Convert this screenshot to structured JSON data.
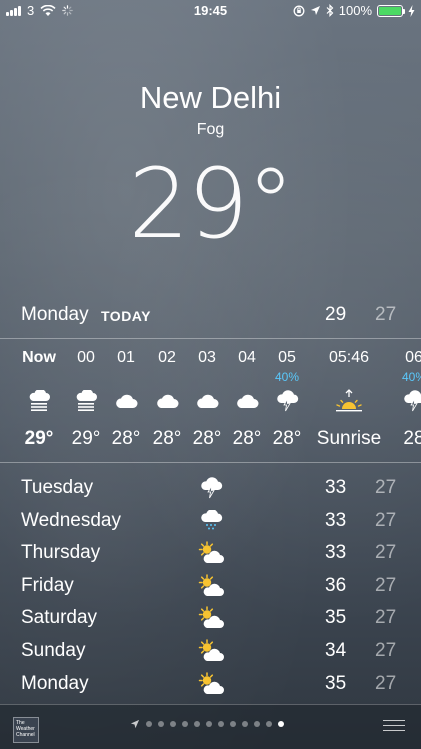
{
  "status_bar": {
    "carrier": "3",
    "time": "19:45",
    "battery": "100%",
    "battery_level": 1.0
  },
  "header": {
    "city": "New Delhi",
    "condition": "Fog",
    "temperature": "29°"
  },
  "today": {
    "day": "Monday",
    "tag": "TODAY",
    "high": "29",
    "low": "27"
  },
  "hourly": [
    {
      "hour": "Now",
      "icon": "fog-icon",
      "precip": "",
      "temp": "29°"
    },
    {
      "hour": "00",
      "icon": "fog-icon",
      "precip": "",
      "temp": "29°"
    },
    {
      "hour": "01",
      "icon": "cloud-icon",
      "precip": "",
      "temp": "28°"
    },
    {
      "hour": "02",
      "icon": "cloud-icon",
      "precip": "",
      "temp": "28°"
    },
    {
      "hour": "03",
      "icon": "cloud-icon",
      "precip": "",
      "temp": "28°"
    },
    {
      "hour": "04",
      "icon": "cloud-icon",
      "precip": "",
      "temp": "28°"
    },
    {
      "hour": "05",
      "icon": "thunderstorm-icon",
      "precip": "40%",
      "temp": "28°"
    },
    {
      "hour": "05:46",
      "icon": "sunrise-icon",
      "precip": "",
      "temp": "Sunrise"
    },
    {
      "hour": "06",
      "icon": "thunderstorm-icon",
      "precip": "40%",
      "temp": "28"
    }
  ],
  "daily": [
    {
      "day": "Tuesday",
      "icon": "thunderstorm-icon",
      "high": "33",
      "low": "27"
    },
    {
      "day": "Wednesday",
      "icon": "rain-cloud-icon",
      "high": "33",
      "low": "27"
    },
    {
      "day": "Thursday",
      "icon": "partly-cloudy-icon",
      "high": "33",
      "low": "27"
    },
    {
      "day": "Friday",
      "icon": "partly-cloudy-icon",
      "high": "36",
      "low": "27"
    },
    {
      "day": "Saturday",
      "icon": "partly-cloudy-icon",
      "high": "35",
      "low": "27"
    },
    {
      "day": "Sunday",
      "icon": "partly-cloudy-icon",
      "high": "34",
      "low": "27"
    },
    {
      "day": "Monday",
      "icon": "partly-cloudy-icon",
      "high": "35",
      "low": "27"
    }
  ],
  "footer": {
    "logo_text": "The Weather Channel",
    "page_count": 12,
    "active_page": 12
  },
  "colors": {
    "precip_blue": "#5ac8fa",
    "battery_green": "#4cd964",
    "sun_yellow": "#f7c331"
  }
}
